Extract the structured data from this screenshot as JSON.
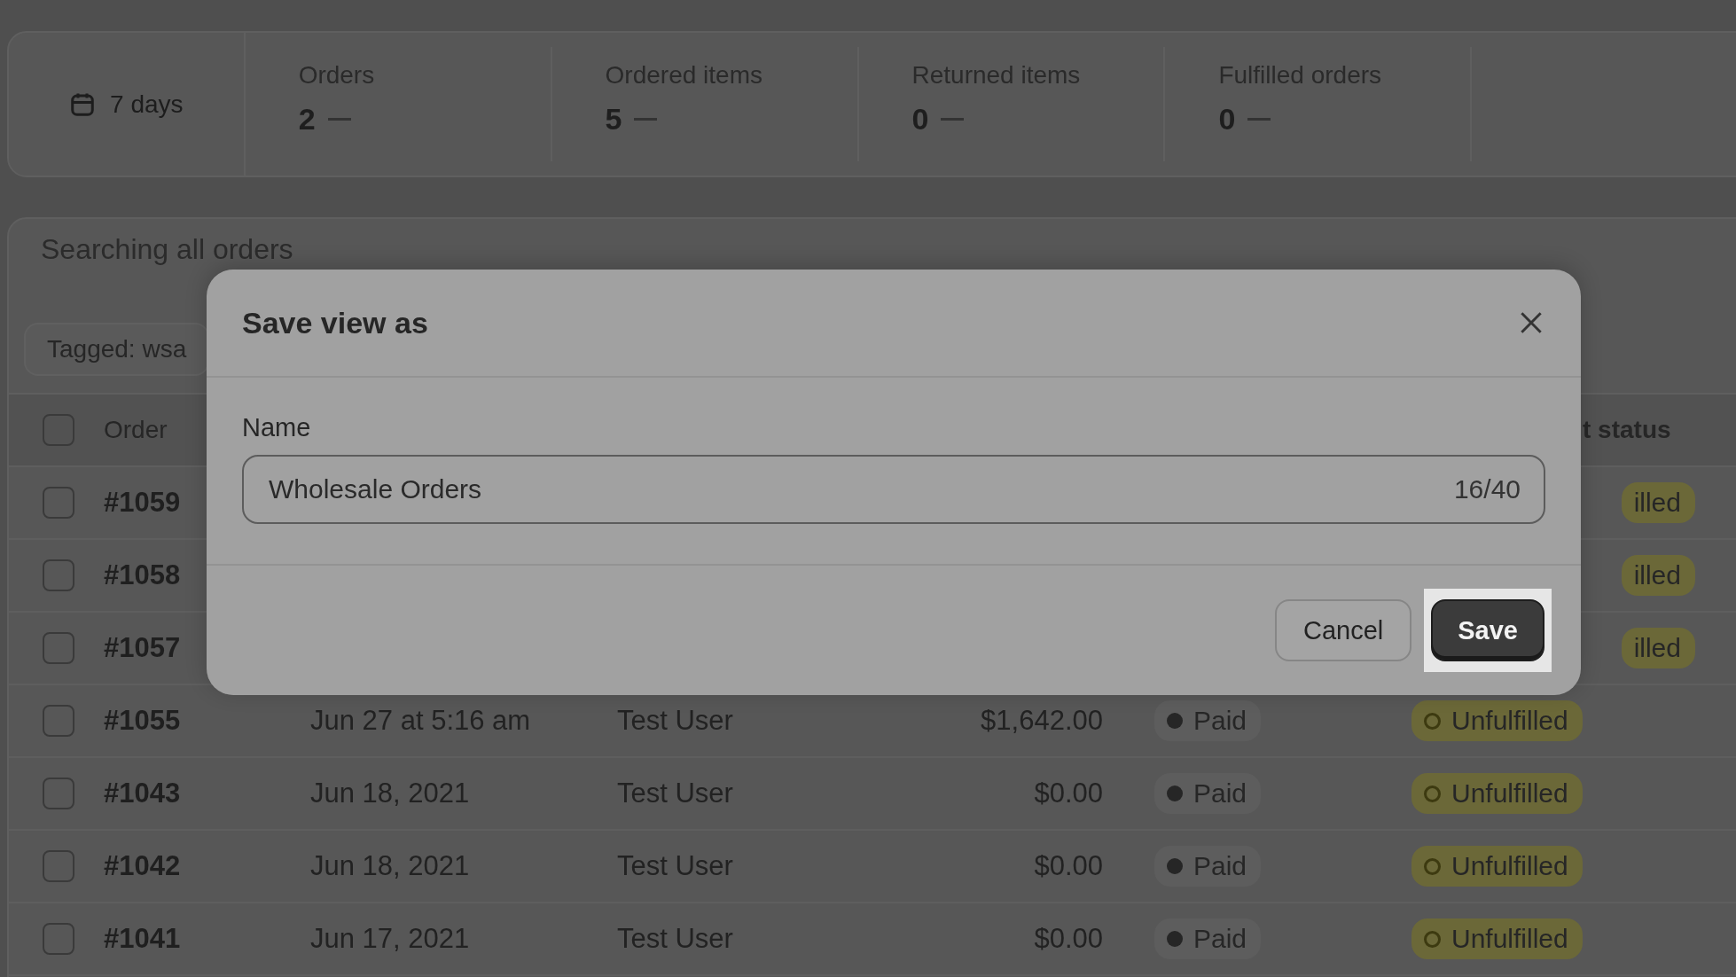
{
  "stats": {
    "period": "7 days",
    "metrics": [
      {
        "label": "Orders",
        "value": "2"
      },
      {
        "label": "Ordered items",
        "value": "5"
      },
      {
        "label": "Returned items",
        "value": "0"
      },
      {
        "label": "Fulfilled orders",
        "value": "0"
      }
    ]
  },
  "orders": {
    "search_text": "Searching all orders",
    "filter_chip": "Tagged: wsa",
    "header_checked": false,
    "columns": [
      "Order",
      "t status"
    ],
    "rows": [
      {
        "order": "#1059",
        "checked": false,
        "clipped": true,
        "fulfillment": "illed"
      },
      {
        "order": "#1058",
        "checked": false,
        "clipped": true,
        "fulfillment": "illed"
      },
      {
        "order": "#1057",
        "checked": false,
        "clipped": true,
        "fulfillment": "illed"
      },
      {
        "order": "#1055",
        "checked": false,
        "clipped": false,
        "date": "Jun 27 at 5:16 am",
        "customer": "Test User",
        "total": "$1,642.00",
        "payment": "Paid",
        "fulfillment": "Unfulfilled"
      },
      {
        "order": "#1043",
        "checked": false,
        "clipped": false,
        "date": "Jun 18, 2021",
        "customer": "Test User",
        "total": "$0.00",
        "payment": "Paid",
        "fulfillment": "Unfulfilled"
      },
      {
        "order": "#1042",
        "checked": false,
        "clipped": false,
        "date": "Jun 18, 2021",
        "customer": "Test User",
        "total": "$0.00",
        "payment": "Paid",
        "fulfillment": "Unfulfilled"
      },
      {
        "order": "#1041",
        "checked": false,
        "clipped": false,
        "date": "Jun 17, 2021",
        "customer": "Test User",
        "total": "$0.00",
        "payment": "Paid",
        "fulfillment": "Unfulfilled"
      }
    ]
  },
  "dialog": {
    "title": "Save view as",
    "field_label": "Name",
    "value": "Wholesale Orders",
    "counter": "16/40",
    "buttons": [
      {
        "label": "Cancel",
        "kind": "secondary",
        "highlighted": false
      },
      {
        "label": "Save",
        "kind": "primary",
        "highlighted": true
      }
    ]
  }
}
